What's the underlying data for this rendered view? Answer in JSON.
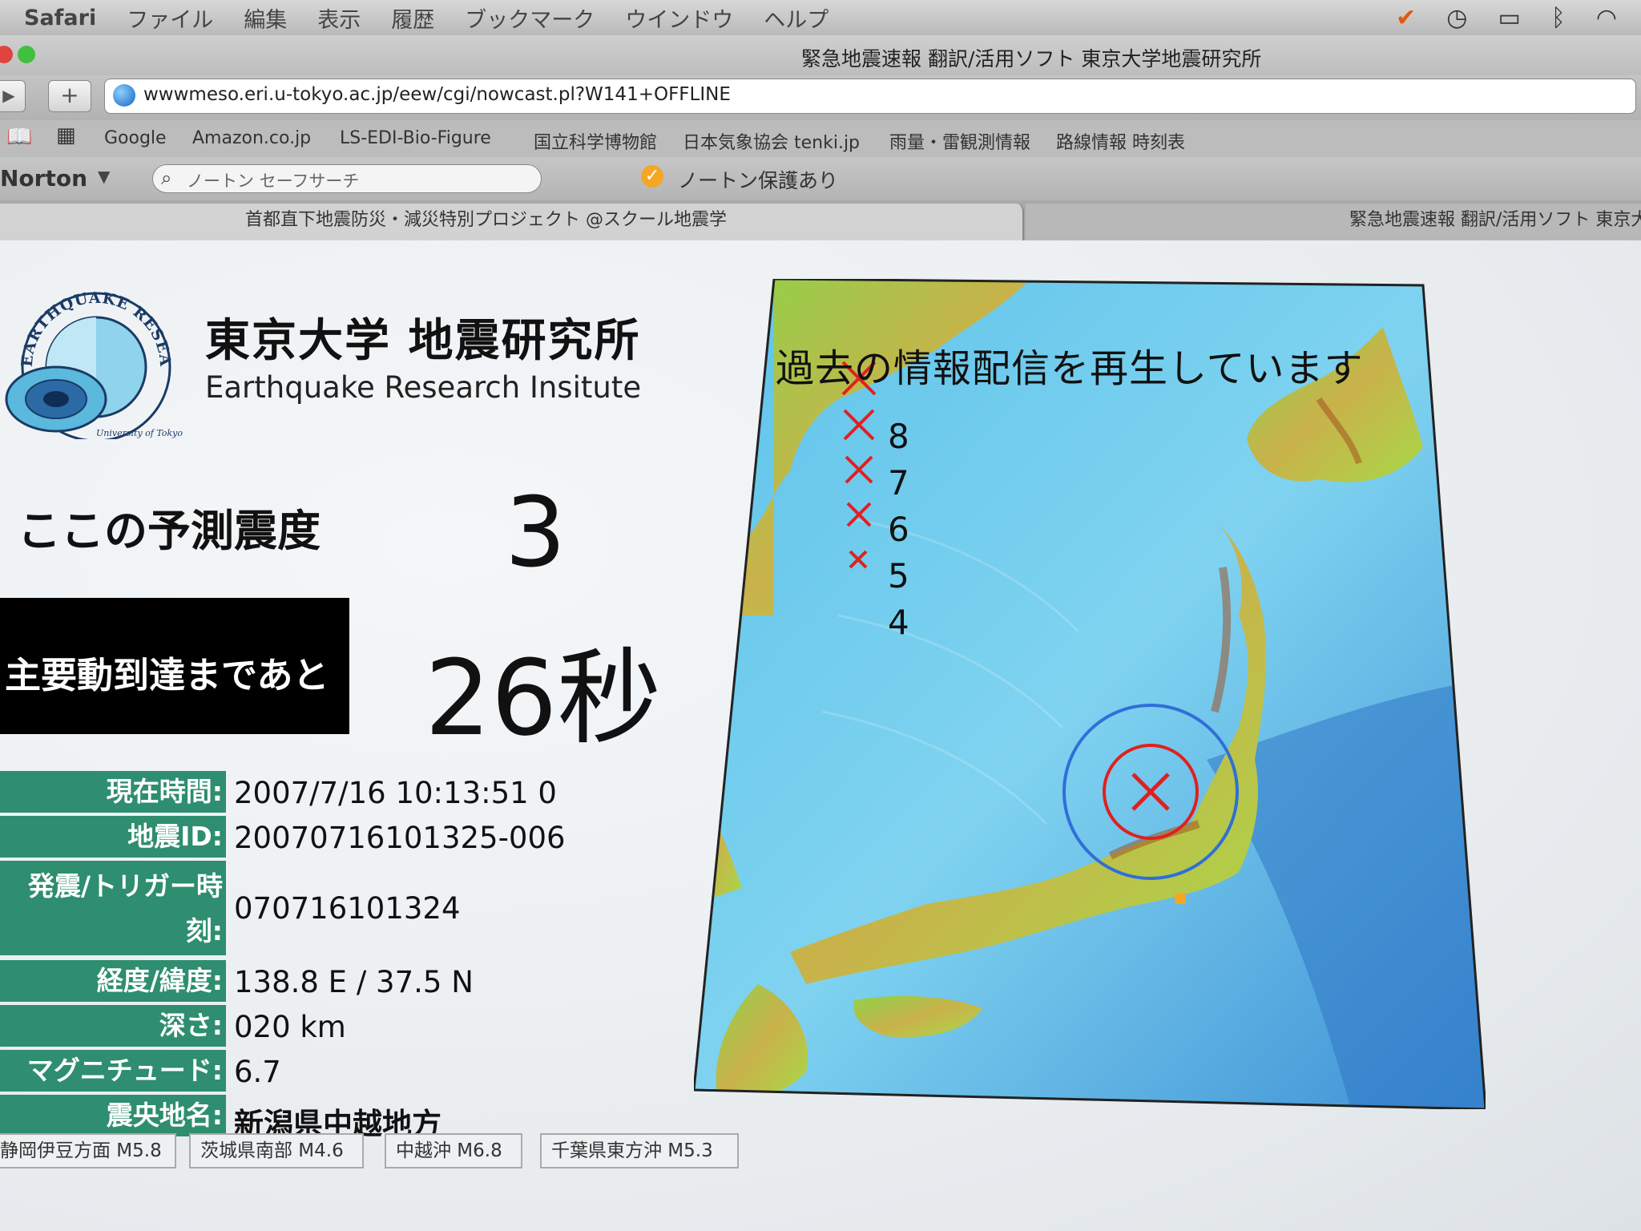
{
  "menubar": {
    "items": [
      "Safari",
      "ファイル",
      "編集",
      "表示",
      "履歴",
      "ブックマーク",
      "ウインドウ",
      "ヘルプ"
    ]
  },
  "window": {
    "title": "緊急地震速報 翻訳/活用ソフト 東京大学地震研究所"
  },
  "toolbar": {
    "back_label": "▶",
    "add_label": "+",
    "url": "wwwmeso.eri.u-tokyo.ac.jp/eew/cgi/nowcast.pl?W141+OFFLINE"
  },
  "bookmarks": [
    "Google",
    "Amazon.co.jp",
    "LS-EDI-Bio-Figure",
    "国立科学博物館",
    "日本気象協会 tenki.jp",
    "雨量・雷観測情報",
    "路線情報 時刻表"
  ],
  "norton": {
    "brand": "Norton",
    "search_placeholder": "ノートン セーフサーチ",
    "protection": "ノートン保護あり"
  },
  "tabs": [
    {
      "label": "首都直下地震防災・減災特別プロジェクト @スクール地震学"
    },
    {
      "label": "緊急地震速報 翻訳/活用ソフト 東京大"
    }
  ],
  "institute": {
    "name_ja": "東京大学 地震研究所",
    "name_en": "Earthquake Research Insitute",
    "logo_ring_text": "EARTHQUAKE RESEARCH INSTITUTE",
    "logo_sub": "University of Tokyo"
  },
  "prediction": {
    "label": "ここの予測震度",
    "value": "3"
  },
  "arrival": {
    "label": "主要動到達まであと",
    "countdown": "26秒",
    "seconds": 26
  },
  "info": [
    {
      "label": "現在時間:",
      "value": "2007/7/16 10:13:51  0"
    },
    {
      "label": "地震ID:",
      "value": "20070716101325-006"
    },
    {
      "label": "発震/トリガー時刻:",
      "value": "070716101324"
    },
    {
      "label": "経度/緯度:",
      "value": "138.8 E / 37.5 N"
    },
    {
      "label": "深さ:",
      "value": "020 km"
    },
    {
      "label": "マグニチュード:",
      "value": "6.7"
    },
    {
      "label": "震央地名:",
      "value": "新潟県中越地方"
    }
  ],
  "history_tabs": [
    "静岡伊豆方面 M5.8",
    "茨城県南部 M4.6",
    "中越沖 M6.8",
    "千葉県東方沖 M5.3"
  ],
  "map": {
    "replay_message": "過去の情報配信を再生しています",
    "legend": [
      "8",
      "7",
      "6",
      "5",
      "4"
    ],
    "epicenter_color": "#e02020",
    "wave_color": "#2f6fd8"
  },
  "colors": {
    "label_bg": "#2e8e6f",
    "arrival_bg": "#000000",
    "accent_orange": "#f5a623"
  }
}
